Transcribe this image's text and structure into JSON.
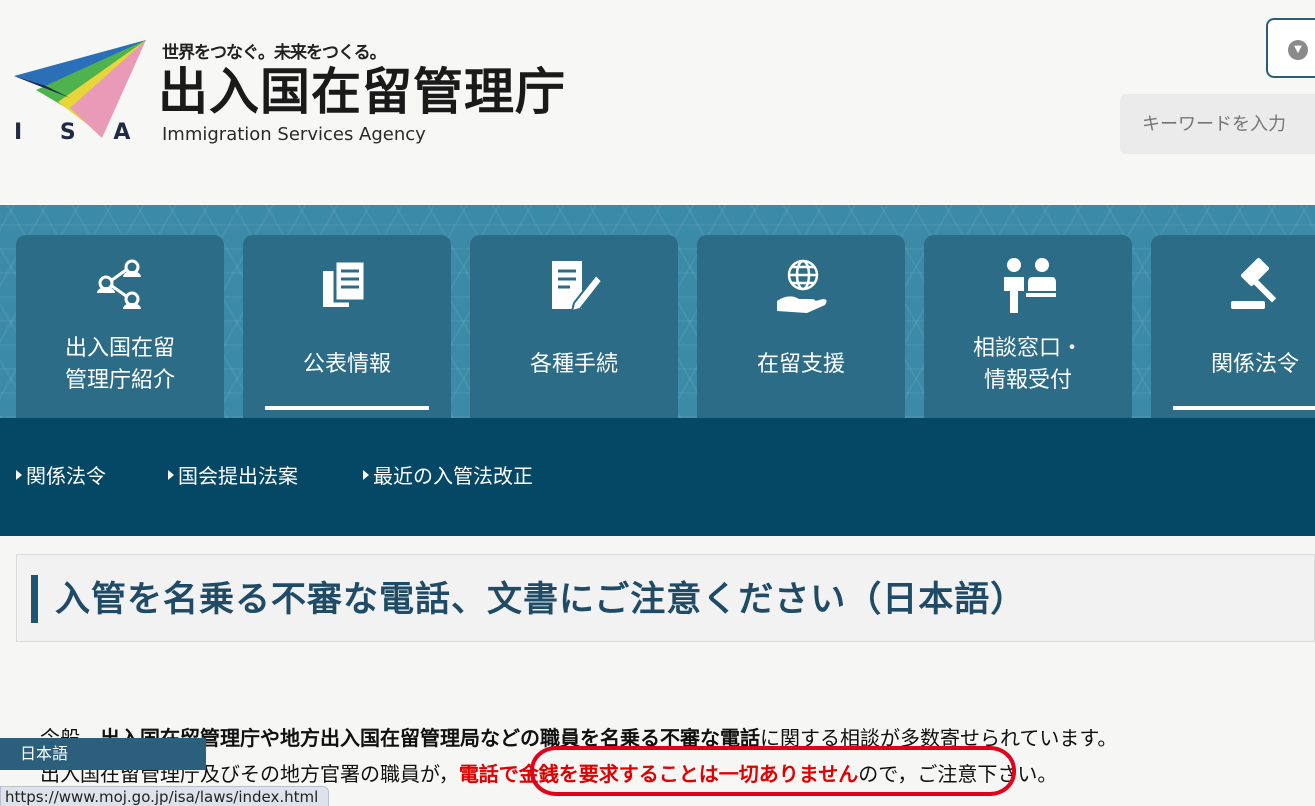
{
  "header": {
    "logo_letters": "I S A",
    "tagline": "世界をつなぐ。未来をつくる。",
    "agency_name": "出入国在留管理庁",
    "agency_name_en": "Immigration Services Agency",
    "search_placeholder": "キーワードを入力",
    "colors": {
      "logo_navy": "#1f2a44",
      "logo_blue": "#2b6fb8",
      "logo_green": "#4fb34d",
      "logo_yellow": "#e7d53a",
      "logo_pink": "#e99ab6"
    }
  },
  "nav": {
    "items": [
      {
        "label": "出入国在留\n管理庁紹介",
        "icon": "people-network-icon",
        "active": false
      },
      {
        "label": "公表情報",
        "icon": "documents-icon",
        "active": true
      },
      {
        "label": "各種手続",
        "icon": "form-pen-icon",
        "active": false
      },
      {
        "label": "在留支援",
        "icon": "globe-hand-icon",
        "active": false
      },
      {
        "label": "相談窓口・\n情報受付",
        "icon": "consultation-icon",
        "active": false
      },
      {
        "label": "関係法令",
        "icon": "gavel-icon",
        "active": true
      }
    ],
    "colors": {
      "band": "#3a8aa8",
      "tile": "#2d6c87"
    }
  },
  "subnav": {
    "items": [
      "関係法令",
      "国会提出法案",
      "最近の入管法改正"
    ],
    "color": "#054866"
  },
  "page": {
    "title": "入管を名乗る不審な電話、文書にご注意ください（日本語）",
    "line1_prefix": "今般，",
    "line1_strong": "出入国在留管理庁や地方出入国在留管理局などの職員を名乗る不審な電話",
    "line1_suffix": "に関する相談が多数寄せられています。",
    "line2_prefix": "出入国在留管理庁及びその地方官署の職員が，",
    "line2_red": "電話で金銭を要求することは一切ありません",
    "line2_suffix": "ので，ご注意下さい。",
    "alert_color": "#e3001b"
  },
  "overlays": {
    "language_tab": "日本語",
    "status_url": "https://www.moj.go.jp/isa/laws/index.html"
  }
}
